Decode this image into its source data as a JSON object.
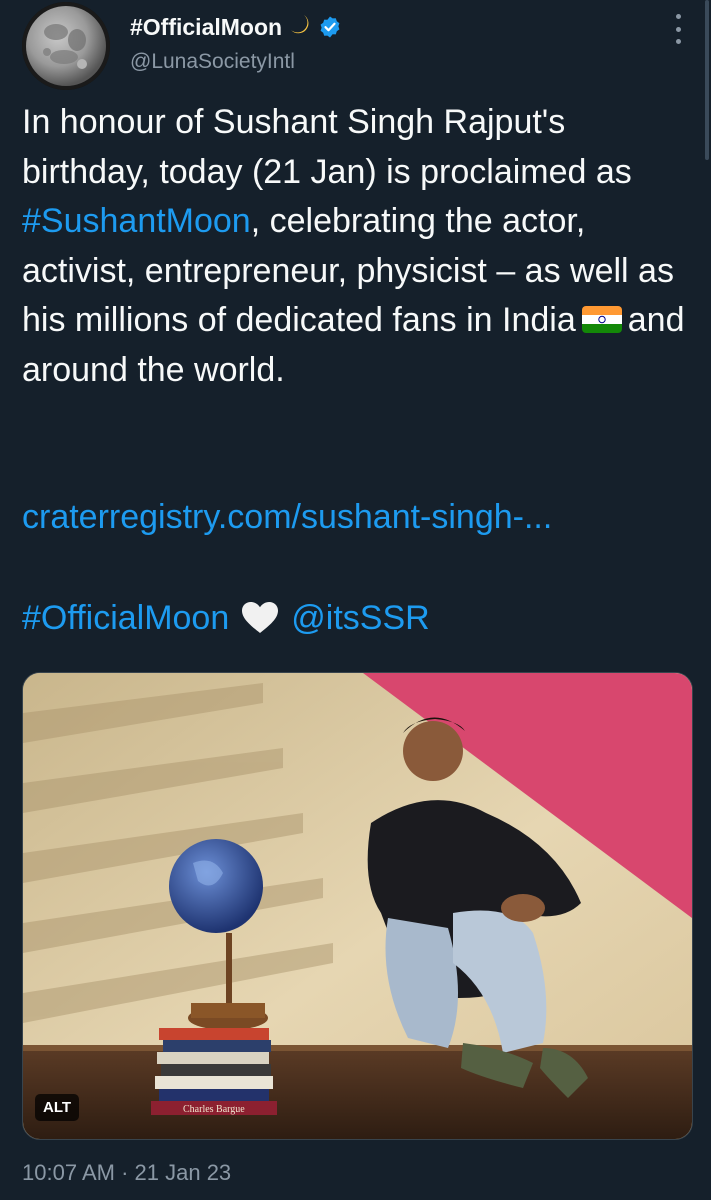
{
  "account": {
    "display_name": "#OfficialMoon",
    "name_emoji": "🌙",
    "handle": "@LunaSocietyIntl",
    "verified": true,
    "verified_color": "#1d9bf0"
  },
  "tweet": {
    "text_intro": "In honour of Sushant Singh Rajput's birthday, today (21 Jan) is proclaimed as ",
    "hashtag_1": "#SushantMoon",
    "text_middle": ", celebrating the actor, activist, entrepreneur, physicist – as well as his millions of dedicated fans in India",
    "flag_icon": "india-flag-emoji",
    "text_end": "and around the world.",
    "trailing_emoji": "crescent-moon-emoji",
    "link_text": "craterregistry.com/sushant-singh-...",
    "hashtag_2": "#OfficialMoon",
    "heart_icon": "white-heart-emoji",
    "mention": "@itsSSR"
  },
  "media": {
    "alt_badge": "ALT",
    "book_spine_text": "Charles Bargue"
  },
  "meta": {
    "time": "10:07 AM",
    "separator": "·",
    "date": "21 Jan 23"
  },
  "colors": {
    "background": "#15202b",
    "text": "#f7f9f9",
    "link": "#1d9bf0",
    "secondary": "#8b98a5"
  }
}
